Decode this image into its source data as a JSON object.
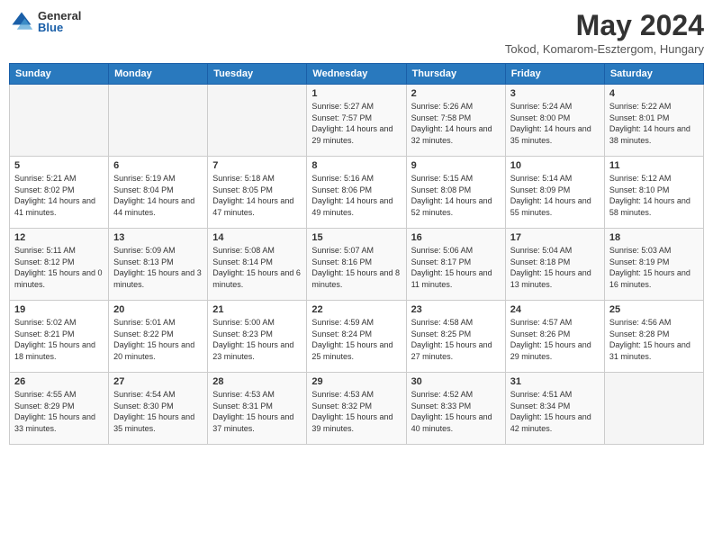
{
  "header": {
    "logo_general": "General",
    "logo_blue": "Blue",
    "title": "May 2024",
    "subtitle": "Tokod, Komarom-Esztergom, Hungary"
  },
  "days_of_week": [
    "Sunday",
    "Monday",
    "Tuesday",
    "Wednesday",
    "Thursday",
    "Friday",
    "Saturday"
  ],
  "weeks": [
    [
      {
        "day": "",
        "sunrise": "",
        "sunset": "",
        "daylight": ""
      },
      {
        "day": "",
        "sunrise": "",
        "sunset": "",
        "daylight": ""
      },
      {
        "day": "",
        "sunrise": "",
        "sunset": "",
        "daylight": ""
      },
      {
        "day": "1",
        "sunrise": "Sunrise: 5:27 AM",
        "sunset": "Sunset: 7:57 PM",
        "daylight": "Daylight: 14 hours and 29 minutes."
      },
      {
        "day": "2",
        "sunrise": "Sunrise: 5:26 AM",
        "sunset": "Sunset: 7:58 PM",
        "daylight": "Daylight: 14 hours and 32 minutes."
      },
      {
        "day": "3",
        "sunrise": "Sunrise: 5:24 AM",
        "sunset": "Sunset: 8:00 PM",
        "daylight": "Daylight: 14 hours and 35 minutes."
      },
      {
        "day": "4",
        "sunrise": "Sunrise: 5:22 AM",
        "sunset": "Sunset: 8:01 PM",
        "daylight": "Daylight: 14 hours and 38 minutes."
      }
    ],
    [
      {
        "day": "5",
        "sunrise": "Sunrise: 5:21 AM",
        "sunset": "Sunset: 8:02 PM",
        "daylight": "Daylight: 14 hours and 41 minutes."
      },
      {
        "day": "6",
        "sunrise": "Sunrise: 5:19 AM",
        "sunset": "Sunset: 8:04 PM",
        "daylight": "Daylight: 14 hours and 44 minutes."
      },
      {
        "day": "7",
        "sunrise": "Sunrise: 5:18 AM",
        "sunset": "Sunset: 8:05 PM",
        "daylight": "Daylight: 14 hours and 47 minutes."
      },
      {
        "day": "8",
        "sunrise": "Sunrise: 5:16 AM",
        "sunset": "Sunset: 8:06 PM",
        "daylight": "Daylight: 14 hours and 49 minutes."
      },
      {
        "day": "9",
        "sunrise": "Sunrise: 5:15 AM",
        "sunset": "Sunset: 8:08 PM",
        "daylight": "Daylight: 14 hours and 52 minutes."
      },
      {
        "day": "10",
        "sunrise": "Sunrise: 5:14 AM",
        "sunset": "Sunset: 8:09 PM",
        "daylight": "Daylight: 14 hours and 55 minutes."
      },
      {
        "day": "11",
        "sunrise": "Sunrise: 5:12 AM",
        "sunset": "Sunset: 8:10 PM",
        "daylight": "Daylight: 14 hours and 58 minutes."
      }
    ],
    [
      {
        "day": "12",
        "sunrise": "Sunrise: 5:11 AM",
        "sunset": "Sunset: 8:12 PM",
        "daylight": "Daylight: 15 hours and 0 minutes."
      },
      {
        "day": "13",
        "sunrise": "Sunrise: 5:09 AM",
        "sunset": "Sunset: 8:13 PM",
        "daylight": "Daylight: 15 hours and 3 minutes."
      },
      {
        "day": "14",
        "sunrise": "Sunrise: 5:08 AM",
        "sunset": "Sunset: 8:14 PM",
        "daylight": "Daylight: 15 hours and 6 minutes."
      },
      {
        "day": "15",
        "sunrise": "Sunrise: 5:07 AM",
        "sunset": "Sunset: 8:16 PM",
        "daylight": "Daylight: 15 hours and 8 minutes."
      },
      {
        "day": "16",
        "sunrise": "Sunrise: 5:06 AM",
        "sunset": "Sunset: 8:17 PM",
        "daylight": "Daylight: 15 hours and 11 minutes."
      },
      {
        "day": "17",
        "sunrise": "Sunrise: 5:04 AM",
        "sunset": "Sunset: 8:18 PM",
        "daylight": "Daylight: 15 hours and 13 minutes."
      },
      {
        "day": "18",
        "sunrise": "Sunrise: 5:03 AM",
        "sunset": "Sunset: 8:19 PM",
        "daylight": "Daylight: 15 hours and 16 minutes."
      }
    ],
    [
      {
        "day": "19",
        "sunrise": "Sunrise: 5:02 AM",
        "sunset": "Sunset: 8:21 PM",
        "daylight": "Daylight: 15 hours and 18 minutes."
      },
      {
        "day": "20",
        "sunrise": "Sunrise: 5:01 AM",
        "sunset": "Sunset: 8:22 PM",
        "daylight": "Daylight: 15 hours and 20 minutes."
      },
      {
        "day": "21",
        "sunrise": "Sunrise: 5:00 AM",
        "sunset": "Sunset: 8:23 PM",
        "daylight": "Daylight: 15 hours and 23 minutes."
      },
      {
        "day": "22",
        "sunrise": "Sunrise: 4:59 AM",
        "sunset": "Sunset: 8:24 PM",
        "daylight": "Daylight: 15 hours and 25 minutes."
      },
      {
        "day": "23",
        "sunrise": "Sunrise: 4:58 AM",
        "sunset": "Sunset: 8:25 PM",
        "daylight": "Daylight: 15 hours and 27 minutes."
      },
      {
        "day": "24",
        "sunrise": "Sunrise: 4:57 AM",
        "sunset": "Sunset: 8:26 PM",
        "daylight": "Daylight: 15 hours and 29 minutes."
      },
      {
        "day": "25",
        "sunrise": "Sunrise: 4:56 AM",
        "sunset": "Sunset: 8:28 PM",
        "daylight": "Daylight: 15 hours and 31 minutes."
      }
    ],
    [
      {
        "day": "26",
        "sunrise": "Sunrise: 4:55 AM",
        "sunset": "Sunset: 8:29 PM",
        "daylight": "Daylight: 15 hours and 33 minutes."
      },
      {
        "day": "27",
        "sunrise": "Sunrise: 4:54 AM",
        "sunset": "Sunset: 8:30 PM",
        "daylight": "Daylight: 15 hours and 35 minutes."
      },
      {
        "day": "28",
        "sunrise": "Sunrise: 4:53 AM",
        "sunset": "Sunset: 8:31 PM",
        "daylight": "Daylight: 15 hours and 37 minutes."
      },
      {
        "day": "29",
        "sunrise": "Sunrise: 4:53 AM",
        "sunset": "Sunset: 8:32 PM",
        "daylight": "Daylight: 15 hours and 39 minutes."
      },
      {
        "day": "30",
        "sunrise": "Sunrise: 4:52 AM",
        "sunset": "Sunset: 8:33 PM",
        "daylight": "Daylight: 15 hours and 40 minutes."
      },
      {
        "day": "31",
        "sunrise": "Sunrise: 4:51 AM",
        "sunset": "Sunset: 8:34 PM",
        "daylight": "Daylight: 15 hours and 42 minutes."
      },
      {
        "day": "",
        "sunrise": "",
        "sunset": "",
        "daylight": ""
      }
    ]
  ]
}
